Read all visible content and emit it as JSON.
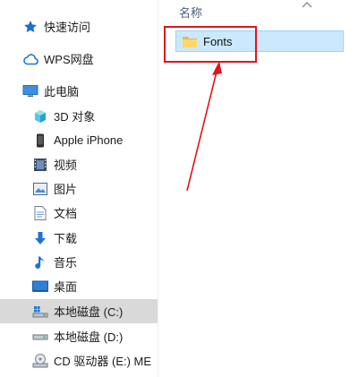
{
  "nav": {
    "items": [
      {
        "label": "快速访问",
        "icon": "star-icon"
      },
      {
        "label": "WPS网盘",
        "icon": "cloud-icon"
      },
      {
        "label": "此电脑",
        "icon": "monitor-icon"
      },
      {
        "label": "3D 对象",
        "icon": "cube-3d-icon"
      },
      {
        "label": "Apple iPhone",
        "icon": "phone-icon"
      },
      {
        "label": "视频",
        "icon": "film-icon"
      },
      {
        "label": "图片",
        "icon": "picture-icon"
      },
      {
        "label": "文档",
        "icon": "document-icon"
      },
      {
        "label": "下载",
        "icon": "download-arrow-icon"
      },
      {
        "label": "音乐",
        "icon": "music-note-icon"
      },
      {
        "label": "桌面",
        "icon": "desktop-icon"
      },
      {
        "label": "本地磁盘 (C:)",
        "icon": "windows-drive-icon"
      },
      {
        "label": "本地磁盘 (D:)",
        "icon": "drive-icon"
      },
      {
        "label": "CD 驱动器 (E:) ME",
        "icon": "cd-drive-icon"
      }
    ],
    "selected_index": 11
  },
  "content": {
    "column_header": "名称",
    "files": [
      {
        "name": "Fonts",
        "icon": "folder-icon"
      }
    ]
  },
  "annotation": {
    "box_color": "#e0151c",
    "arrow_color": "#e0151c"
  }
}
